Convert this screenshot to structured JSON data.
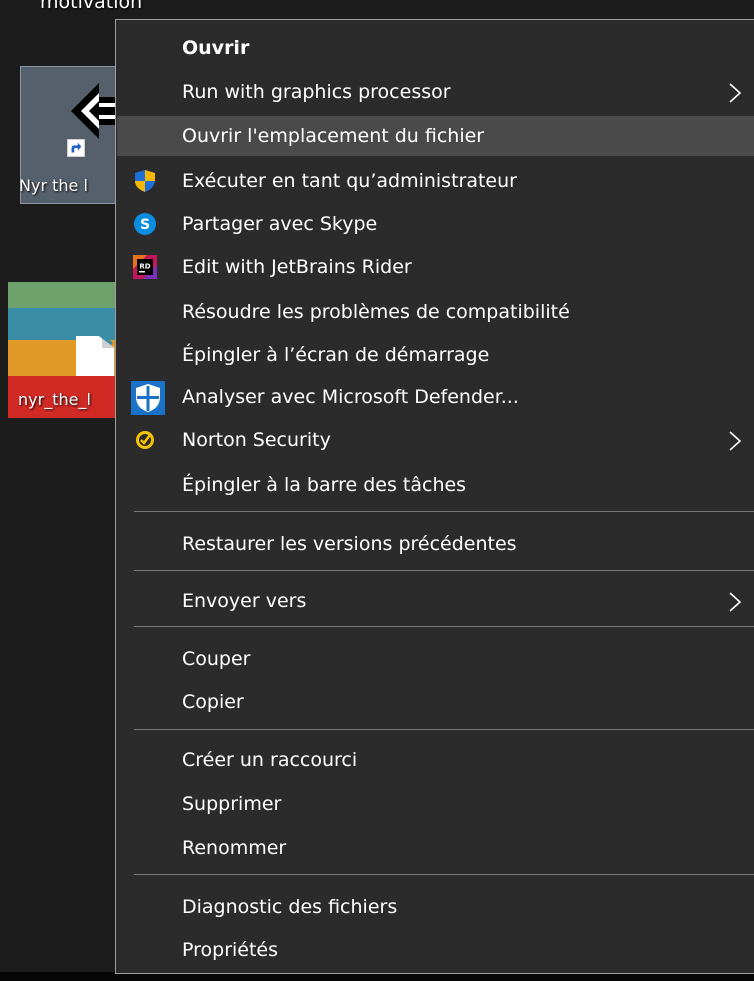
{
  "desktop": {
    "top_label": "motivation",
    "icon1_label": "Nyr the l",
    "icon2_label": "nyr_the_l"
  },
  "context_menu": {
    "items": [
      {
        "label": "Ouvrir"
      },
      {
        "label": "Run with graphics processor"
      },
      {
        "label": "Ouvrir l'emplacement du fichier"
      },
      {
        "label": "Exécuter en tant qu’administrateur"
      },
      {
        "label": "Partager avec Skype"
      },
      {
        "label": "Edit with JetBrains Rider"
      },
      {
        "label": "Résoudre les problèmes de compatibilité"
      },
      {
        "label": "Épingler à l’écran de démarrage"
      },
      {
        "label": "Analyser avec Microsoft Defender..."
      },
      {
        "label": "Norton Security"
      },
      {
        "label": "Épingler à la barre des tâches"
      },
      {
        "label": "Restaurer les versions précédentes"
      },
      {
        "label": "Envoyer vers"
      },
      {
        "label": "Couper"
      },
      {
        "label": "Copier"
      },
      {
        "label": "Créer un raccourci"
      },
      {
        "label": "Supprimer"
      },
      {
        "label": "Renommer"
      },
      {
        "label": "Diagnostic des fichiers"
      },
      {
        "label": "Propriétés"
      }
    ],
    "icons": {
      "jetbrains_badge": "RD",
      "skype_badge": "S"
    },
    "highlighted_item": "Ouvrir l'emplacement du fichier"
  },
  "colors": {
    "menu_background": "#2b2b2b",
    "menu_highlight": "#4a4a4a",
    "menu_border": "#a0a0a0",
    "separator": "#7a7a7a",
    "text": "#ffffff",
    "icon_selection": "#56606c",
    "skype_blue": "#0a8de0",
    "defender_blue": "#1a73c8",
    "norton_yellow": "#f5c400",
    "shield_yellow": "#f5b800",
    "shield_blue": "#1e6fd9",
    "band_green": "#6fa16c",
    "band_teal": "#3a8da6",
    "band_orange": "#e19a28",
    "band_red": "#d12a25"
  }
}
